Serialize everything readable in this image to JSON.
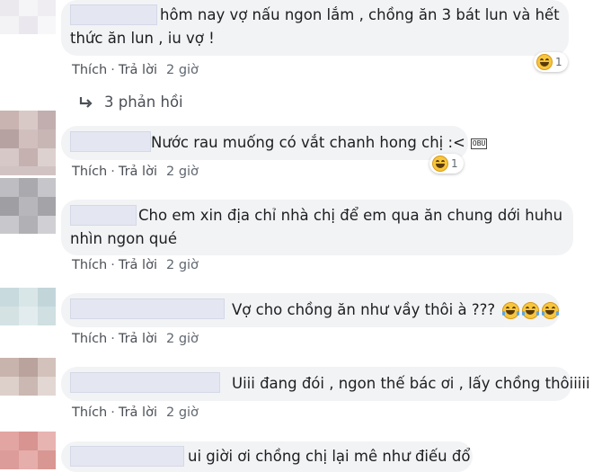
{
  "actions": {
    "like": "Thích",
    "reply": "Trả lời"
  },
  "colors": {
    "bubble": "#f2f3f5",
    "link": "#4b4f56",
    "meta": "#606770"
  },
  "reply_link": {
    "icon": "reply-arrow-icon",
    "label": "3 phản hồi"
  },
  "comments": [
    {
      "line1": "hôm nay vợ nấu ngon lắm , chồng ăn 3 bát lun và hết",
      "line2": "thức ăn lun , iu vợ !",
      "time": "2 giờ",
      "reaction_icon": "laughing-emoji-icon",
      "reaction_count": "1"
    },
    {
      "line1": "Nước rau muống có vắt chanh hong chị :<",
      "sticker": "OBU",
      "time": "2 giờ",
      "reaction_icon": "laughing-emoji-icon",
      "reaction_count": "1"
    },
    {
      "line1": "Cho em xin địa chỉ nhà chị để em qua ăn chung dới huhu",
      "line2": "nhìn ngon qué",
      "time": "2 giờ"
    },
    {
      "line1": "Vợ cho chồng ăn như vầy thôi à ???",
      "inline_emoji": [
        "rofl-emoji-icon",
        "rofl-emoji-icon",
        "rofl-emoji-icon"
      ],
      "time": "2 giờ"
    },
    {
      "line1": "Uiii đang đói , ngon thế bác ơi , lấy chồng thôiiiii",
      "time": "2 giờ"
    },
    {
      "line1": "ui giời ơi chồng chị lại mê như điếu đổ"
    }
  ]
}
